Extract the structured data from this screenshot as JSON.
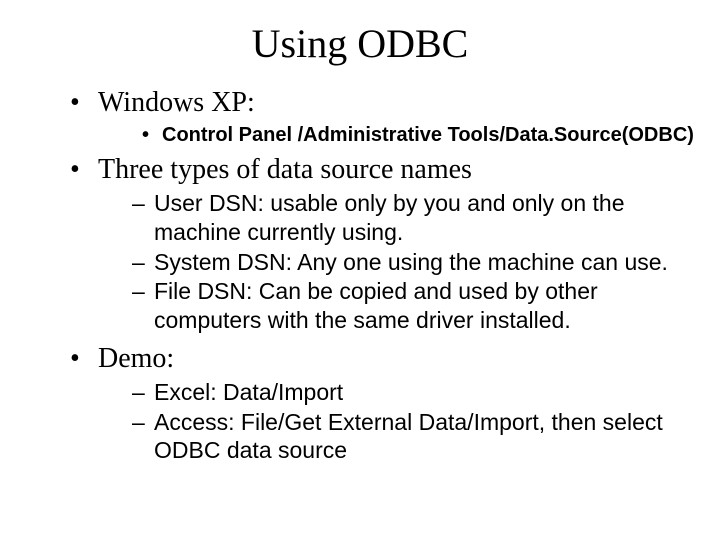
{
  "title": "Using ODBC",
  "items": [
    {
      "label": "Windows XP:",
      "sub_bullet": [
        "Control Panel /Administrative Tools/Data.Source(ODBC)"
      ]
    },
    {
      "label": "Three types of data source names",
      "sub_dash": [
        "User DSN: usable only by you and only on the machine currently using.",
        "System DSN: Any one using the machine can use.",
        "File DSN: Can be copied and used by other computers with the same driver installed."
      ]
    },
    {
      "label": "Demo:",
      "sub_dash": [
        "Excel: Data/Import",
        "Access: File/Get External Data/Import, then select ODBC data source"
      ]
    }
  ]
}
